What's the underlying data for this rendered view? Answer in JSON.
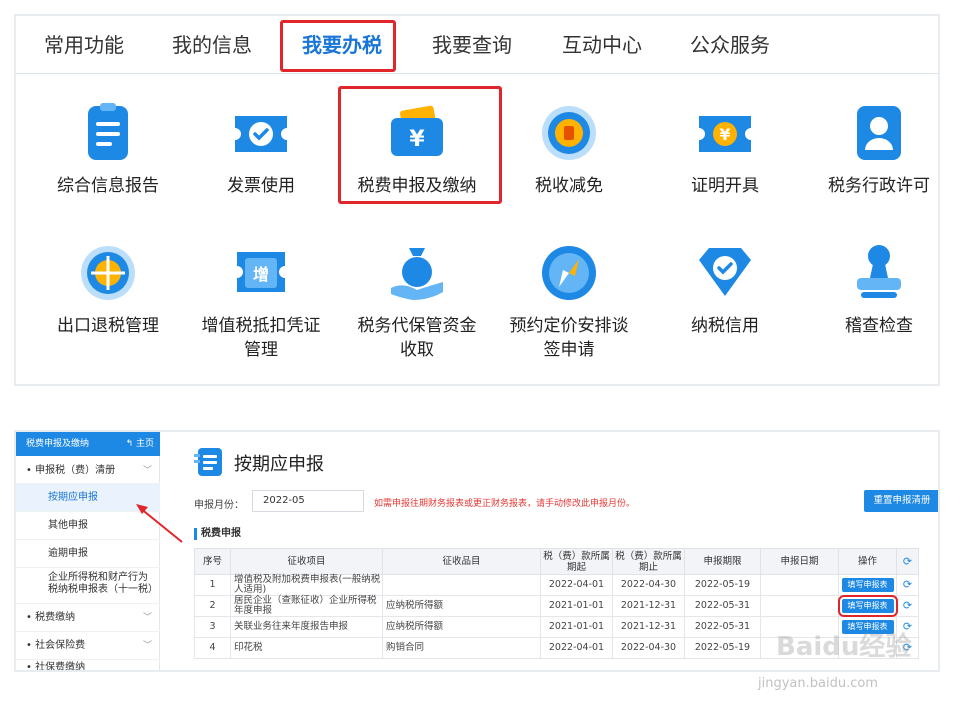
{
  "top": {
    "tabs": [
      "常用功能",
      "我的信息",
      "我要办税",
      "我要查询",
      "互动中心",
      "公众服务"
    ],
    "active_tab": "我要办税",
    "services": [
      {
        "label": "综合信息报告",
        "icon": "clipboard-icon"
      },
      {
        "label": "发票使用",
        "icon": "ticket-check-icon"
      },
      {
        "label": "税费申报及缴纳",
        "icon": "wallet-yuan-icon"
      },
      {
        "label": "税收减免",
        "icon": "coin-stack-icon"
      },
      {
        "label": "证明开具",
        "icon": "ticket-yuan-icon"
      },
      {
        "label": "税务行政许可",
        "icon": "id-card-icon"
      },
      {
        "label": "出口退税管理",
        "icon": "globe-icon"
      },
      {
        "label": "增值税抵扣凭证\n管理",
        "icon": "ticket-zeng-icon"
      },
      {
        "label": "税务代保管资金\n收取",
        "icon": "money-bag-hand-icon"
      },
      {
        "label": "预约定价安排谈\n签申请",
        "icon": "compass-icon"
      },
      {
        "label": "纳税信用",
        "icon": "diamond-check-icon"
      },
      {
        "label": "稽查检查",
        "icon": "stamp-icon"
      }
    ]
  },
  "sidebar": {
    "title": "税费申报及缴纳",
    "home": "主页",
    "items": [
      {
        "label": "申报税（费）清册",
        "type": "group"
      },
      {
        "label": "按期应申报",
        "type": "sub"
      },
      {
        "label": "其他申报",
        "type": "sub"
      },
      {
        "label": "逾期申报",
        "type": "sub"
      },
      {
        "label": "企业所得税和财产行为税纳税申报表（十一税）",
        "type": "sub"
      },
      {
        "label": "税费缴纳",
        "type": "group"
      },
      {
        "label": "社会保险费",
        "type": "group"
      },
      {
        "label": "社保费缴纳",
        "type": "group"
      }
    ]
  },
  "main": {
    "title": "按期应申报",
    "month_label": "申报月份：",
    "month_value": "2022-05",
    "warning": "如需申报往期财务报表或更正财务报表，请手动修改此申报月份。",
    "reset_button": "重置申报清册",
    "section_title": "税费申报",
    "columns": [
      "序号",
      "征收项目",
      "征收品目",
      "税（费）款所属期起",
      "税（费）款所属期止",
      "申报期限",
      "申报日期",
      "操作"
    ],
    "rows": [
      {
        "no": "1",
        "item": "增值税及附加税费申报表(一般纳税人适用)",
        "sub": "",
        "from": "2022-04-01",
        "to": "2022-04-30",
        "deadline": "2022-05-19",
        "date": "",
        "op": "填写申报表"
      },
      {
        "no": "2",
        "item": "居民企业（查账征收）企业所得税年度申报",
        "sub": "应纳税所得额",
        "from": "2021-01-01",
        "to": "2021-12-31",
        "deadline": "2022-05-31",
        "date": "",
        "op": "填写申报表"
      },
      {
        "no": "3",
        "item": "关联业务往来年度报告申报",
        "sub": "应纳税所得额",
        "from": "2021-01-01",
        "to": "2021-12-31",
        "deadline": "2022-05-31",
        "date": "",
        "op": "填写申报表"
      },
      {
        "no": "4",
        "item": "印花税",
        "sub": "购销合同",
        "from": "2022-04-01",
        "to": "2022-04-30",
        "deadline": "2022-05-19",
        "date": "",
        "op": ""
      }
    ]
  },
  "watermark": {
    "brand": "Baidu经验",
    "url": "jingyan.baidu.com"
  },
  "colors": {
    "accent": "#1e88e5",
    "highlight": "#e0262a",
    "warning": "#e53935"
  }
}
